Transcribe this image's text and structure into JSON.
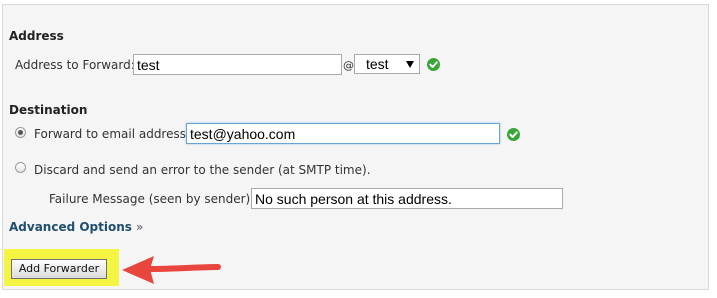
{
  "address": {
    "title": "Address",
    "forward_label": "Address to Forward:",
    "forward_value": "test",
    "at": "@",
    "domain_value": "test"
  },
  "destination": {
    "title": "Destination",
    "forward_email_label": "Forward to email address:",
    "forward_email_value": "test@yahoo.com",
    "discard_label": "Discard and send an error to the sender (at SMTP time).",
    "failure_label": "Failure Message (seen by sender):",
    "failure_value": "No such person at this address."
  },
  "advanced_options": {
    "label": "Advanced Options",
    "suffix": "»"
  },
  "add_button_label": "Add Forwarder",
  "colors": {
    "valid_check": "#3aa637",
    "highlight": "#f4f442",
    "arrow": "#e8453c",
    "link": "#1f4e6e"
  },
  "icons": {
    "valid": "check-circle-icon",
    "pointer": "arrow-left-icon"
  }
}
